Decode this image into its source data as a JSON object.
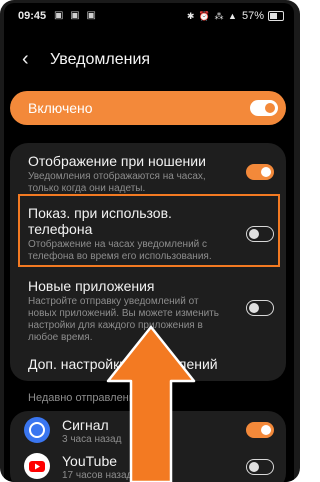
{
  "status_bar": {
    "time": "09:45",
    "left_icons": "▣ ▣ ▣",
    "right_icons": "✱ ⏰ ⁂ ▲",
    "battery": "57%"
  },
  "header": {
    "back_icon": "‹",
    "title": "Уведомления"
  },
  "master_toggle": {
    "label": "Включено",
    "state": "on"
  },
  "settings": {
    "items": [
      {
        "title": "Отображение при ношении",
        "description": "Уведомления отображаются на часах, только когда они надеты.",
        "state": "on"
      },
      {
        "title": "Показ. при использов. телефона",
        "description": "Отображение на часах уведомлений с телефона во время его использования.",
        "state": "off"
      },
      {
        "title": "Новые приложения",
        "description": "Настройте отправку уведомлений от новых приложений. Вы можете изменить настройки для каждого приложения в любое время.",
        "state": "off"
      }
    ],
    "more": "Доп. настройки уведомлений"
  },
  "recent": {
    "section_label": "Недавно отправленные",
    "apps": [
      {
        "name": "Сигнал",
        "time": "3 часа назад",
        "state": "on"
      },
      {
        "name": "YouTube",
        "time": "17 часов назад",
        "state": "off"
      }
    ]
  },
  "colors": {
    "accent": "#f3893a",
    "highlight": "#f37a22",
    "signal_blue": "#3a76f0",
    "youtube_red": "#ff0000"
  }
}
